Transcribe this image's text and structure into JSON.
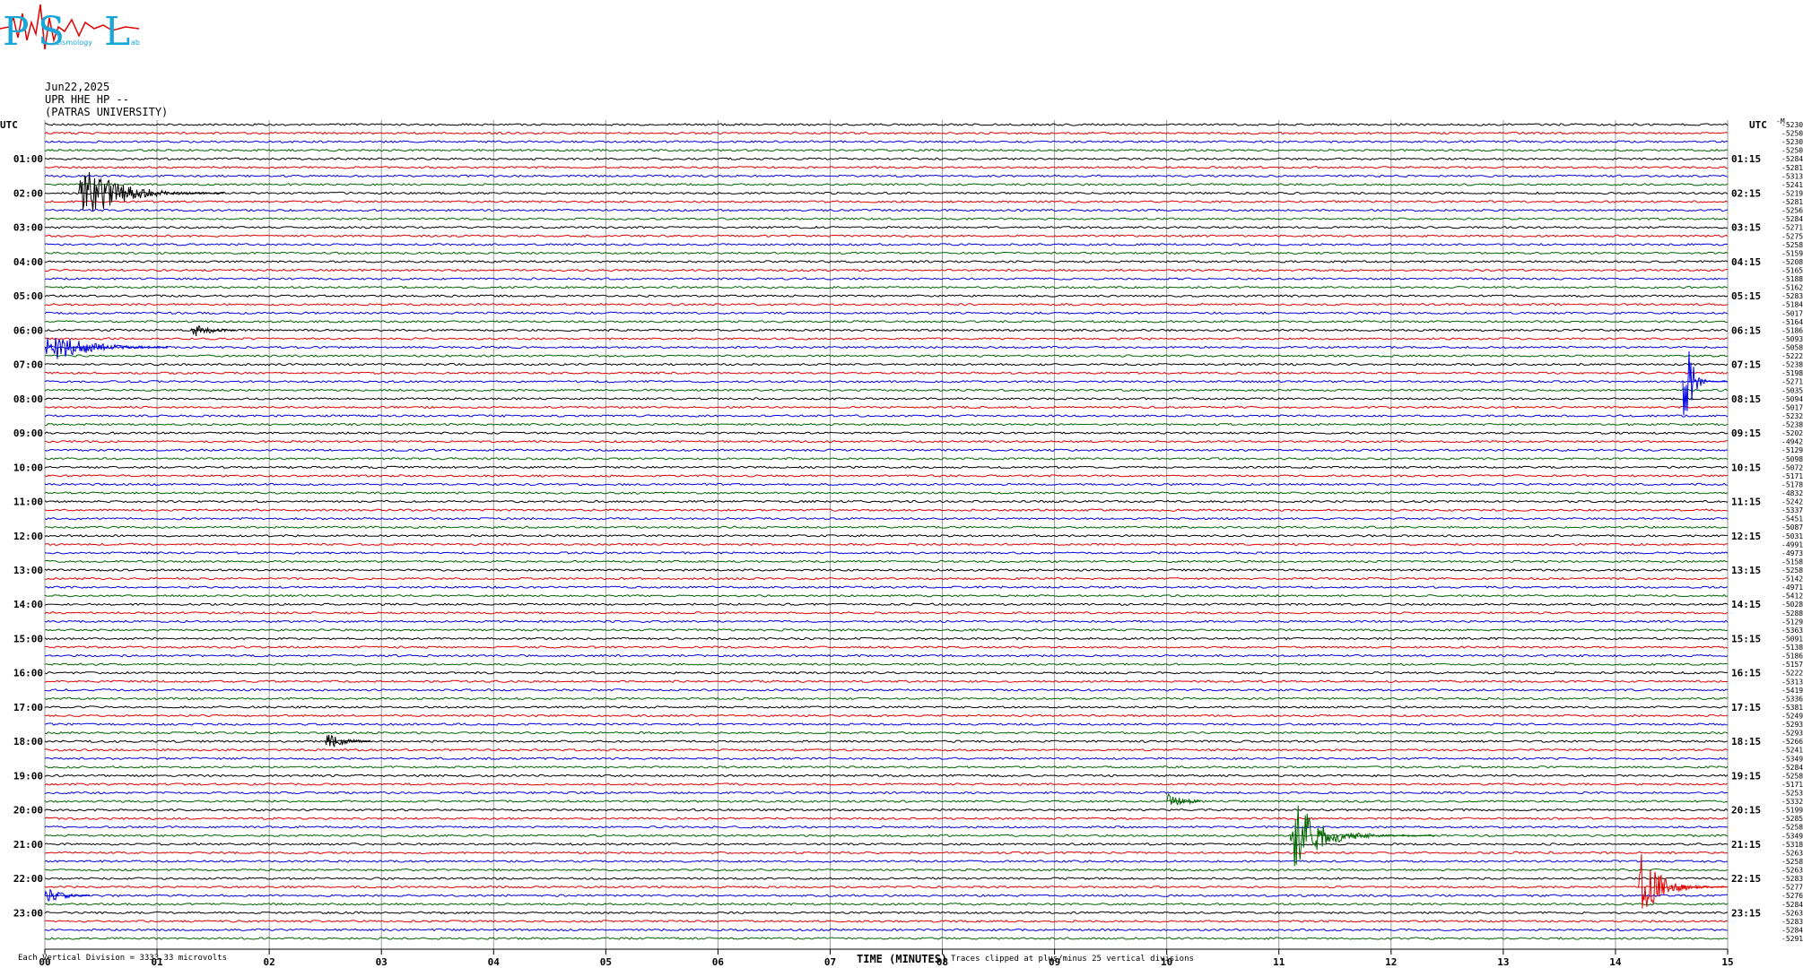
{
  "logo": {
    "big_letters": "PSL",
    "small_text": "eismology",
    "small_text2": "ab"
  },
  "header": {
    "date": "Jun22,2025",
    "station": "UPR HHE HP --",
    "institution": "(PATRAS UNIVERSITY)"
  },
  "axes": {
    "left_label": "UTC",
    "right_label": "UTC",
    "xlabel": "TIME (MINUTES)",
    "scale_note": "Each Vertical Division = 3333.33 microvolts",
    "clip_note": "Traces clipped at plus/minus 25 vertical divisions",
    "corner_mark": "-M"
  },
  "chart_data": {
    "type": "line",
    "title": "",
    "xlim": [
      0,
      15
    ],
    "x_ticks": [
      "00",
      "01",
      "02",
      "03",
      "04",
      "05",
      "06",
      "07",
      "08",
      "09",
      "10",
      "11",
      "12",
      "13",
      "14",
      "15"
    ],
    "num_traces": 96,
    "trace_colors": [
      "#000000",
      "#e00000",
      "#0000e0",
      "#006400"
    ],
    "left_hour_labels": [
      "01:00",
      "02:00",
      "03:00",
      "04:00",
      "05:00",
      "06:00",
      "07:00",
      "08:00",
      "09:00",
      "10:00",
      "11:00",
      "12:00",
      "13:00",
      "14:00",
      "15:00",
      "16:00",
      "17:00",
      "18:00",
      "19:00",
      "20:00",
      "21:00",
      "22:00",
      "23:00"
    ],
    "right_hour_labels": [
      "01:15",
      "02:15",
      "03:15",
      "04:15",
      "05:15",
      "06:15",
      "07:15",
      "08:15",
      "09:15",
      "10:15",
      "11:15",
      "12:15",
      "13:15",
      "14:15",
      "15:15",
      "16:15",
      "17:15",
      "18:15",
      "19:15",
      "20:15",
      "21:15",
      "22:15",
      "23:15"
    ],
    "trace_offsets": [
      "-5230",
      "-5250",
      "-5230",
      "-5250",
      "-5284",
      "-5281",
      "-5313",
      "-5241",
      "-5219",
      "-5281",
      "-5256",
      "-5284",
      "-5271",
      "-5275",
      "-5258",
      "-5159",
      "-5208",
      "-5165",
      "-5188",
      "-5162",
      "-5283",
      "-5184",
      "-5017",
      "-5164",
      "-5186",
      "-5093",
      "-5058",
      "-5222",
      "-5238",
      "-5198",
      "-5271",
      "-5035",
      "-5094",
      "-5017",
      "-5232",
      "-5238",
      "-5202",
      "-4942",
      "-5129",
      "-5098",
      "-5072",
      "-5171",
      "-5178",
      "-4832",
      "-5242",
      "-5337",
      "-5451",
      "-5087",
      "-5031",
      "-4991",
      "-4973",
      "-5158",
      "-5258",
      "-5142",
      "-4971",
      "-5412",
      "-5028",
      "-5288",
      "-5129",
      "-5363",
      "-5091",
      "-5138",
      "-5186",
      "-5157",
      "-5222",
      "-5313",
      "-5419",
      "-5336",
      "-5381",
      "-5249",
      "-5293",
      "-5293",
      "-5266",
      "-5241",
      "-5349",
      "-5284",
      "-5258",
      "-5171",
      "-5253",
      "-5332",
      "-5199",
      "-5285",
      "-5258",
      "-5349",
      "-5318",
      "-5263",
      "-5258",
      "-5263",
      "-5283",
      "-5277",
      "-5276",
      "-5284",
      "-5263",
      "-5283",
      "-5284",
      "-5291"
    ],
    "events": [
      {
        "trace": 8,
        "start_min": 0.3,
        "duration_min": 1.3,
        "peak_div": 4,
        "decay": 0.9
      },
      {
        "trace": 24,
        "start_min": 1.3,
        "duration_min": 0.4,
        "peak_div": 1,
        "decay": 1.5
      },
      {
        "trace": 26,
        "start_min": 0.0,
        "duration_min": 1.1,
        "peak_div": 2,
        "decay": 1.2
      },
      {
        "trace": 30,
        "start_min": 14.6,
        "duration_min": 0.4,
        "peak_div": 12,
        "decay": 0.5,
        "carry_over_traces": [
          21,
          22,
          23,
          24,
          25,
          26,
          27,
          28,
          29
        ]
      },
      {
        "trace": 72,
        "start_min": 2.5,
        "duration_min": 0.4,
        "peak_div": 1,
        "decay": 1.5
      },
      {
        "trace": 79,
        "start_min": 10.0,
        "duration_min": 0.3,
        "peak_div": 1,
        "decay": 2.0
      },
      {
        "trace": 83,
        "start_min": 11.1,
        "duration_min": 1.3,
        "peak_div": 5,
        "decay": 0.7
      },
      {
        "trace": 89,
        "start_min": 14.2,
        "duration_min": 0.8,
        "peak_div": 5,
        "decay": 0.8
      },
      {
        "trace": 90,
        "start_min": 0.0,
        "duration_min": 0.4,
        "peak_div": 1,
        "decay": 1.5
      }
    ]
  }
}
